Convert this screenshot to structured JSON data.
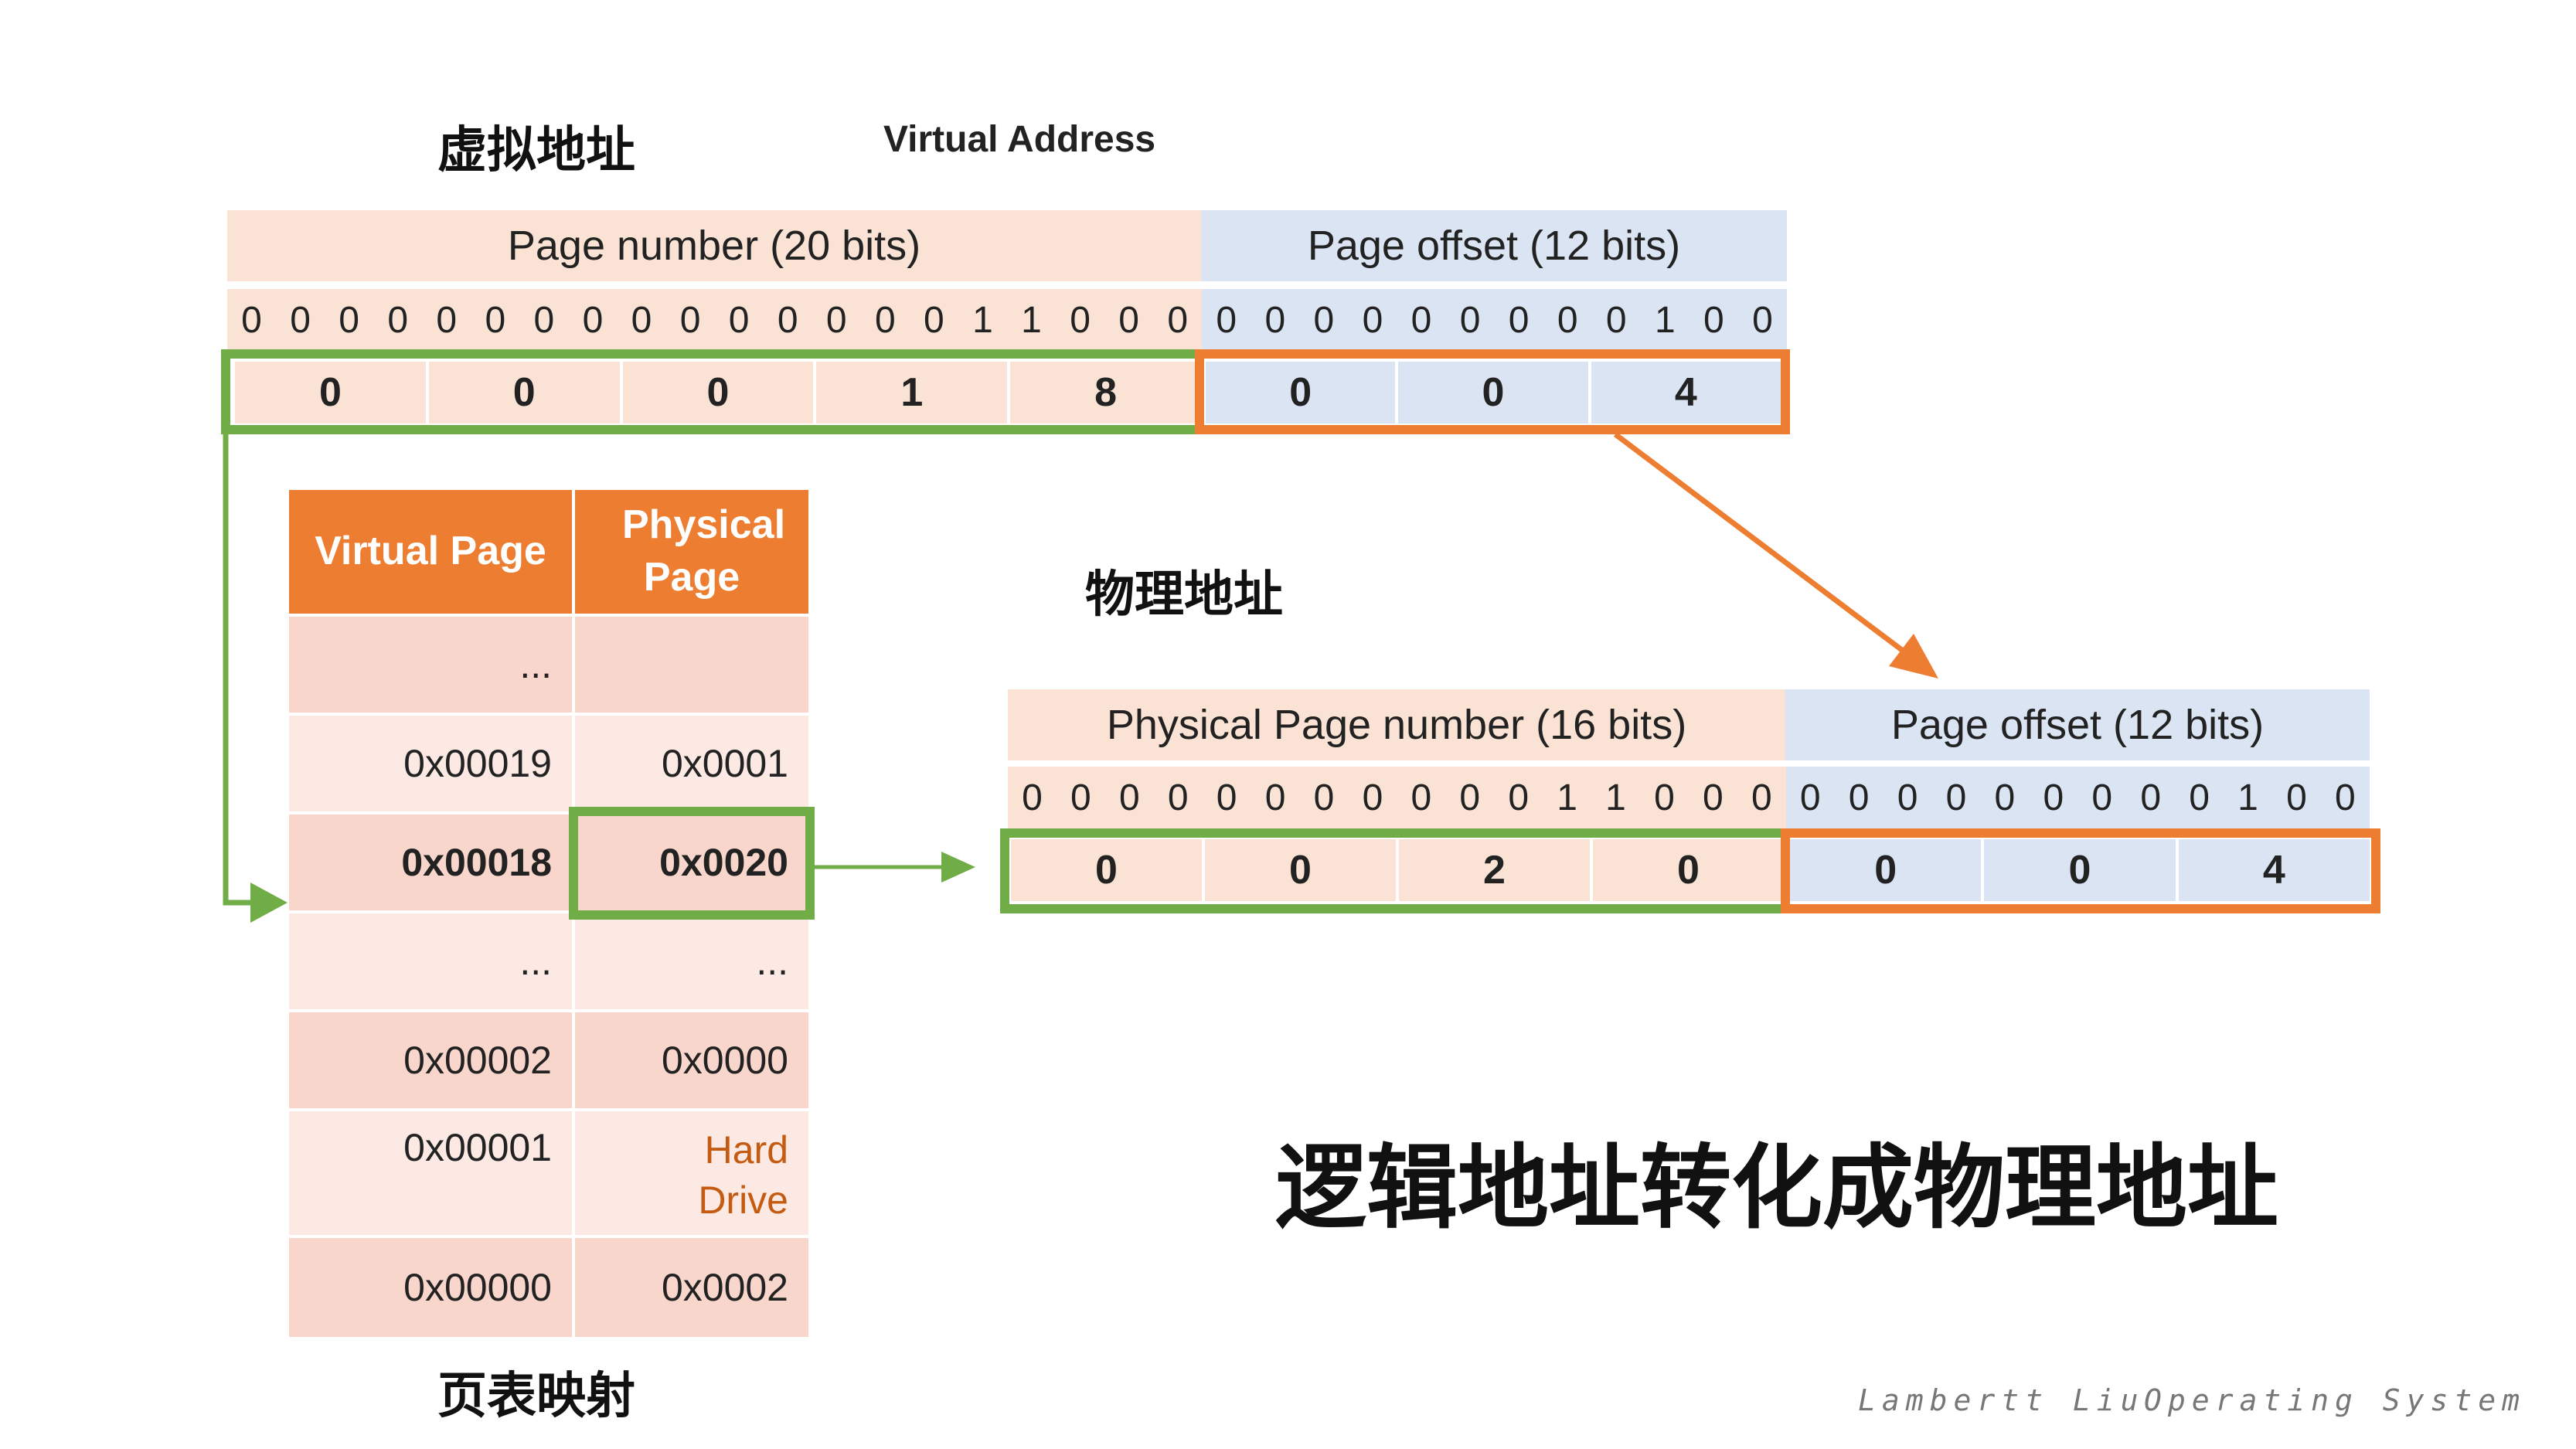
{
  "labels": {
    "virtual_cn": "虚拟地址",
    "virtual_en": "Virtual Address",
    "physical_cn": "物理地址",
    "page_table_cn": "页表映射",
    "title": "逻辑地址转化成物理地址",
    "footer_author": "Lambertt Liu",
    "footer_subject": "Operating System"
  },
  "virtual_address": {
    "page_number_header": "Page number (20 bits)",
    "page_offset_header": "Page offset (12 bits)",
    "bits": [
      "0",
      "0",
      "0",
      "0",
      "0",
      "0",
      "0",
      "0",
      "0",
      "0",
      "0",
      "0",
      "0",
      "0",
      "0",
      "1",
      "1",
      "0",
      "0",
      "0",
      "0",
      "0",
      "0",
      "0",
      "0",
      "0",
      "0",
      "0",
      "0",
      "1",
      "0",
      "0"
    ],
    "hex_page": [
      "0",
      "0",
      "0",
      "1",
      "8"
    ],
    "hex_offset": [
      "0",
      "0",
      "4"
    ]
  },
  "physical_address": {
    "page_number_header": "Physical Page number (16 bits)",
    "page_offset_header": "Page offset (12 bits)",
    "bits": [
      "0",
      "0",
      "0",
      "0",
      "0",
      "0",
      "0",
      "0",
      "0",
      "0",
      "0",
      "1",
      "1",
      "0",
      "0",
      "0",
      "0",
      "0",
      "0",
      "0",
      "0",
      "0",
      "0",
      "0",
      "0",
      "1",
      "0",
      "0"
    ],
    "hex_page": [
      "0",
      "0",
      "2",
      "0"
    ],
    "hex_offset": [
      "0",
      "0",
      "4"
    ]
  },
  "page_table": {
    "header_virtual": "Virtual Page",
    "header_physical": "Physical Page",
    "rows": [
      {
        "virtual": "...",
        "physical": ""
      },
      {
        "virtual": "0x00019",
        "physical": "0x0001"
      },
      {
        "virtual": "0x00018",
        "physical": "0x0020"
      },
      {
        "virtual": "...",
        "physical": "..."
      },
      {
        "virtual": "0x00002",
        "physical": "0x0000"
      },
      {
        "virtual": "0x00001",
        "physical": "Hard Drive"
      },
      {
        "virtual": "0x00000",
        "physical": "0x0002"
      }
    ]
  },
  "colors": {
    "orange": "#ed7d31",
    "green": "#70ad47",
    "peach": "#fae3d4",
    "blue": "#dbe4f3",
    "hard_drive_text": "#c55a11"
  }
}
